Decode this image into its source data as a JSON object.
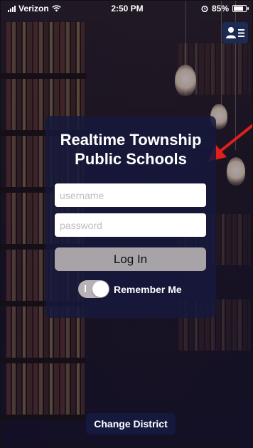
{
  "status_bar": {
    "carrier": "Verizon",
    "time": "2:50 PM",
    "battery_percent_text": "85%",
    "battery_level": 0.85
  },
  "header": {
    "profile_menu_icon": "person-menu-icon"
  },
  "login_card": {
    "title": "Realtime Township Public Schools",
    "username_placeholder": "username",
    "password_placeholder": "password",
    "login_label": "Log In",
    "remember_me_label": "Remember Me",
    "remember_me_on": true
  },
  "footer": {
    "change_district_label": "Change District"
  },
  "colors": {
    "card_bg": "#16183c",
    "login_button": "#a7a3a6",
    "annotation_arrow": "#e0201b"
  }
}
